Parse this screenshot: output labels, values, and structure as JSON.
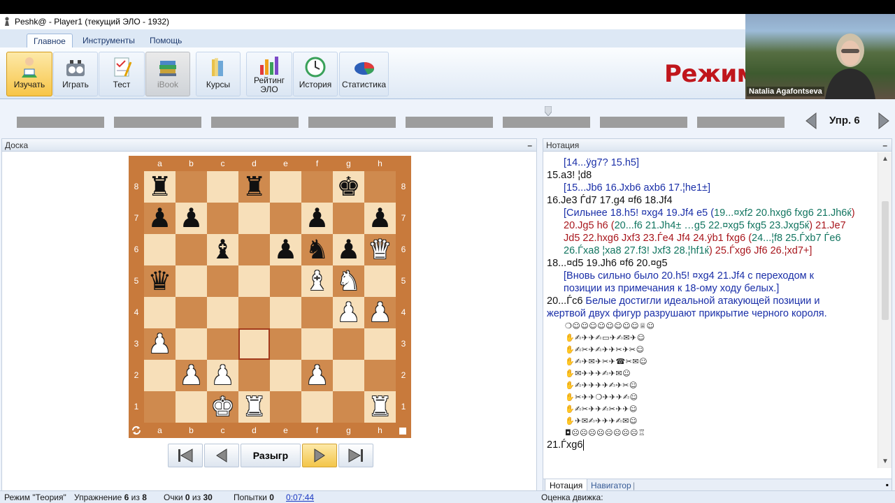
{
  "window": {
    "title": "Peshk@ -  Player1 (текущий ЭЛО - 1932)"
  },
  "ribbon_tabs": [
    "Главное",
    "Инструменты",
    "Помощь"
  ],
  "ribbon": {
    "study": "Изучать",
    "play": "Играть",
    "test": "Тест",
    "ibook": "iBook",
    "courses": "Курсы",
    "rating_line1": "Рейтинг",
    "rating_line2": "ЭЛО",
    "history": "История",
    "stats": "Статистика"
  },
  "mode_title": "Режим",
  "video": {
    "name": "Natalia Agafontseva"
  },
  "progress": {
    "segments": 8,
    "current_segment": 6
  },
  "exercise_nav": {
    "label": "Упр. 6"
  },
  "board_panel": {
    "title": "Доска",
    "minimize": "–"
  },
  "notation_panel": {
    "title": "Нотация",
    "minimize": "–"
  },
  "board": {
    "files": [
      "a",
      "b",
      "c",
      "d",
      "e",
      "f",
      "g",
      "h"
    ],
    "ranks": [
      "8",
      "7",
      "6",
      "5",
      "4",
      "3",
      "2",
      "1"
    ],
    "highlight": "d3",
    "rows": [
      [
        "br",
        "",
        "",
        "br",
        "",
        "",
        "bk",
        ""
      ],
      [
        "bp",
        "bp",
        "",
        "",
        "",
        "bp",
        "",
        "bp"
      ],
      [
        "",
        "",
        "bb",
        "",
        "bp",
        "bn",
        "bp",
        "wq"
      ],
      [
        "bq",
        "",
        "",
        "",
        "",
        "wb",
        "wn",
        ""
      ],
      [
        "",
        "",
        "",
        "",
        "",
        "",
        "wp",
        "wp"
      ],
      [
        "wp",
        "",
        "",
        "",
        "",
        "",
        "",
        ""
      ],
      [
        "",
        "wp",
        "wp",
        "",
        "",
        "wp",
        "",
        ""
      ],
      [
        "",
        "",
        "wk",
        "wr",
        "",
        "",
        "",
        "wr"
      ]
    ]
  },
  "controls": {
    "play_label": "Разыгр"
  },
  "notation": {
    "l1": "[14...ÿg7? 15.h5]",
    "l2": "15.a3! ¦d8",
    "l3": "[15...Jb6 16.Jxb6 axb6 17.¦he1±]",
    "l4": "16.Je3 Ѓd7 17.g4 ¤f6 18.Jf4",
    "l5a": "[Сильнее 18.h5! ¤xg4 19.Jf4 e5 (",
    "l5b": "19...¤xf2 20.hxg6 fxg6 21.Jh6ќ",
    "l6a": "20.Jg5 h6 (",
    "l6b": "20...f6 21.Jh4± …g5 22.¤xg5 fxg5 23.Jxg5ќ",
    "l6c": ") 21.Je7",
    "l7a": "Jd5 22.hxg6 Jxf3 23.Ѓe4 Jf4 24.ÿb1 fxg6 (",
    "l7b": "24...¦f8 25.Ѓxb7 Ѓe6",
    "l8a": "26.Ѓxa8 ¦xa8 27.f3! Jxf3 28.¦hf1ќ",
    "l8b": ") 25.Ѓxg6 Jf6 26.¦xd7+]",
    "l9": "18...¤d5 19.Jh6 ¤f6 20.¤g5",
    "l10": "[Вновь сильно было 20.h5! ¤xg4 21.Jf4 с переходом к",
    "l11": "позиции из примечания к 18-ому ходу белых.]",
    "l12a": "20...Ѓc6",
    "l12b": "Белые достигли идеальной атакующей позиции и",
    "l13": "жертвой двух фигур разрушают прикрытие черного короля.",
    "g1": "❍☺☺☺☺☺☺☺☺♕☺",
    "g2": "✋✍✈✈✍▭✈✍✉✈☺",
    "g3": "✋✍✂✈✍✈✈✂✈✂☺",
    "g4": "✋✍✈✉✈✂✈☎✂✉☺",
    "g5": "✋✉✈✈✈✍✈✉☺",
    "g6": "✋✍✈✈✈✈✍✈✂☺",
    "g7": "✋✂✈✈❍✈✈✈✍☺",
    "g8": "✋✍✂✈✈✍✂✈✈☺",
    "g9": "✋✈✉✍✈✈✈✍✉☺",
    "g10": "◘☹☹☹☹☹☹☹☹♖",
    "l14": "21.Ѓxg6",
    "tabs": [
      "Нотация",
      "Навигатор"
    ]
  },
  "status": {
    "mode": "Режим \"Теория\"",
    "exercise_label": "Упражнение",
    "exercise_num": "6",
    "exercise_of": "из",
    "exercise_total": "8",
    "points_label": "Очки",
    "points_num": "0",
    "points_of": "из",
    "points_total": "30",
    "attempts_label": "Попытки",
    "attempts_num": "0",
    "time": "0:07:44",
    "engine_eval": "Оценка движка:"
  },
  "colors": {
    "accent": "#c0161c",
    "board_dark": "#cf8a4e",
    "board_light": "#f7dfb9",
    "frame": "#c87a3c"
  }
}
